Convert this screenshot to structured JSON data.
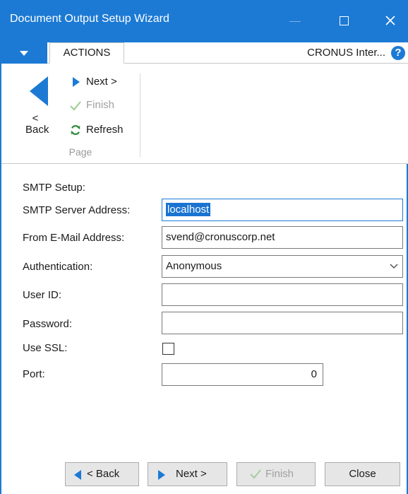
{
  "window": {
    "title": "Document Output Setup Wizard"
  },
  "ribbon_tabs": {
    "actions": "ACTIONS",
    "company": "CRONUS Inter...",
    "help_icon": "?"
  },
  "ribbon": {
    "back": "<\nBack",
    "back_lt": "<",
    "back_word": "Back",
    "next": "Next >",
    "finish": "Finish",
    "refresh": "Refresh",
    "group": "Page"
  },
  "form": {
    "section": "SMTP Setup:",
    "smtp_server_label": "SMTP Server Address:",
    "smtp_server_value": "localhost",
    "from_email_label": "From E-Mail Address:",
    "from_email_value": "svend@cronuscorp.net",
    "auth_label": "Authentication:",
    "auth_value": "Anonymous",
    "user_id_label": "User ID:",
    "user_id_value": "",
    "password_label": "Password:",
    "password_value": "",
    "use_ssl_label": "Use SSL:",
    "use_ssl_checked": false,
    "port_label": "Port:",
    "port_value": "0"
  },
  "buttons": {
    "back": "< Back",
    "next": "Next >",
    "finish": "Finish",
    "close": "Close"
  },
  "colors": {
    "accent": "#1c7ad4",
    "disabled": "#a0a0a0",
    "refresh_green": "#2e8b3a"
  }
}
